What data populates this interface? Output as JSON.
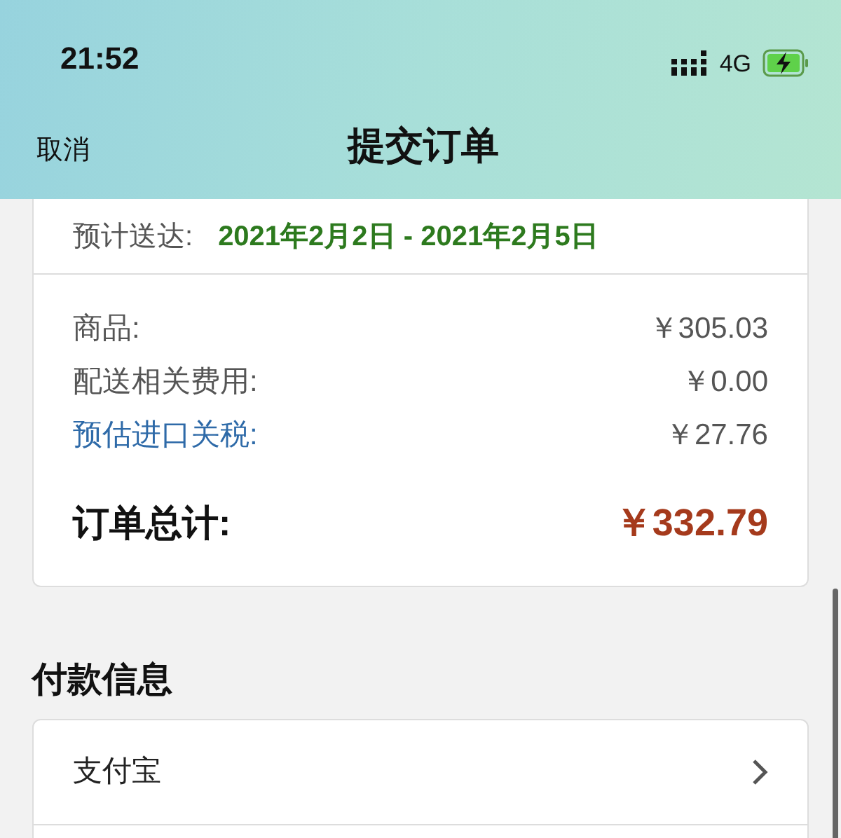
{
  "status_bar": {
    "time": "21:52",
    "network": "4G",
    "charging": true
  },
  "nav": {
    "cancel": "取消",
    "title": "提交订单"
  },
  "delivery": {
    "label": "预计送达:",
    "dates": "2021年2月2日 - 2021年2月5日"
  },
  "summary": [
    {
      "kind": "plain",
      "label": "商品:",
      "value": "￥305.03"
    },
    {
      "kind": "plain",
      "label": "配送相关费用:",
      "value": "￥0.00"
    },
    {
      "kind": "link",
      "label": "预估进口关税:",
      "value": "￥27.76"
    },
    {
      "kind": "total",
      "label": "订单总计:",
      "value": "￥332.79"
    }
  ],
  "payment": {
    "heading": "付款信息",
    "options": [
      {
        "label": "支付宝"
      }
    ]
  }
}
